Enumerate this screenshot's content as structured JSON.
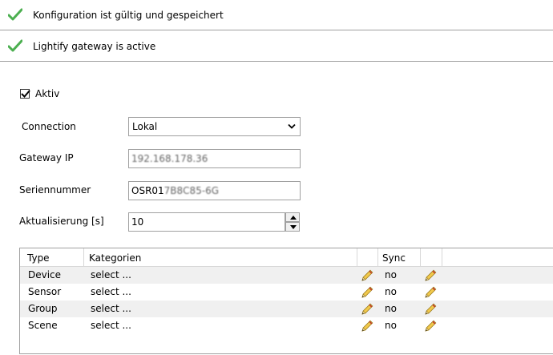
{
  "status": [
    {
      "text": "Konfiguration ist gültig und gespeichert"
    },
    {
      "text": "Lightify gateway is active"
    }
  ],
  "form": {
    "aktiv_label": "Aktiv",
    "aktiv_checked": true,
    "connection_label": "Connection",
    "connection_value": "Lokal",
    "gateway_ip_label": "Gateway IP",
    "gateway_ip_value": "192.168.178.36",
    "seriennummer_label": "Seriennummer",
    "seriennummer_value_visible": "OSR01",
    "seriennummer_value_blurred": "7B8C85-6G",
    "aktualisierung_label": "Aktualisierung [s]",
    "aktualisierung_value": "10"
  },
  "table": {
    "headers": {
      "type": "Type",
      "kategorien": "Kategorien",
      "sync": "Sync"
    },
    "rows": [
      {
        "type": "Device",
        "kategorie": "select ...",
        "sync": "no"
      },
      {
        "type": "Sensor",
        "kategorie": "select ...",
        "sync": "no"
      },
      {
        "type": "Group",
        "kategorie": "select ...",
        "sync": "no"
      },
      {
        "type": "Scene",
        "kategorie": "select ...",
        "sync": "no"
      }
    ]
  },
  "colors": {
    "check_green": "#4caf50",
    "pencil_yellow": "#f2c94c",
    "border": "#a0a0a0"
  }
}
